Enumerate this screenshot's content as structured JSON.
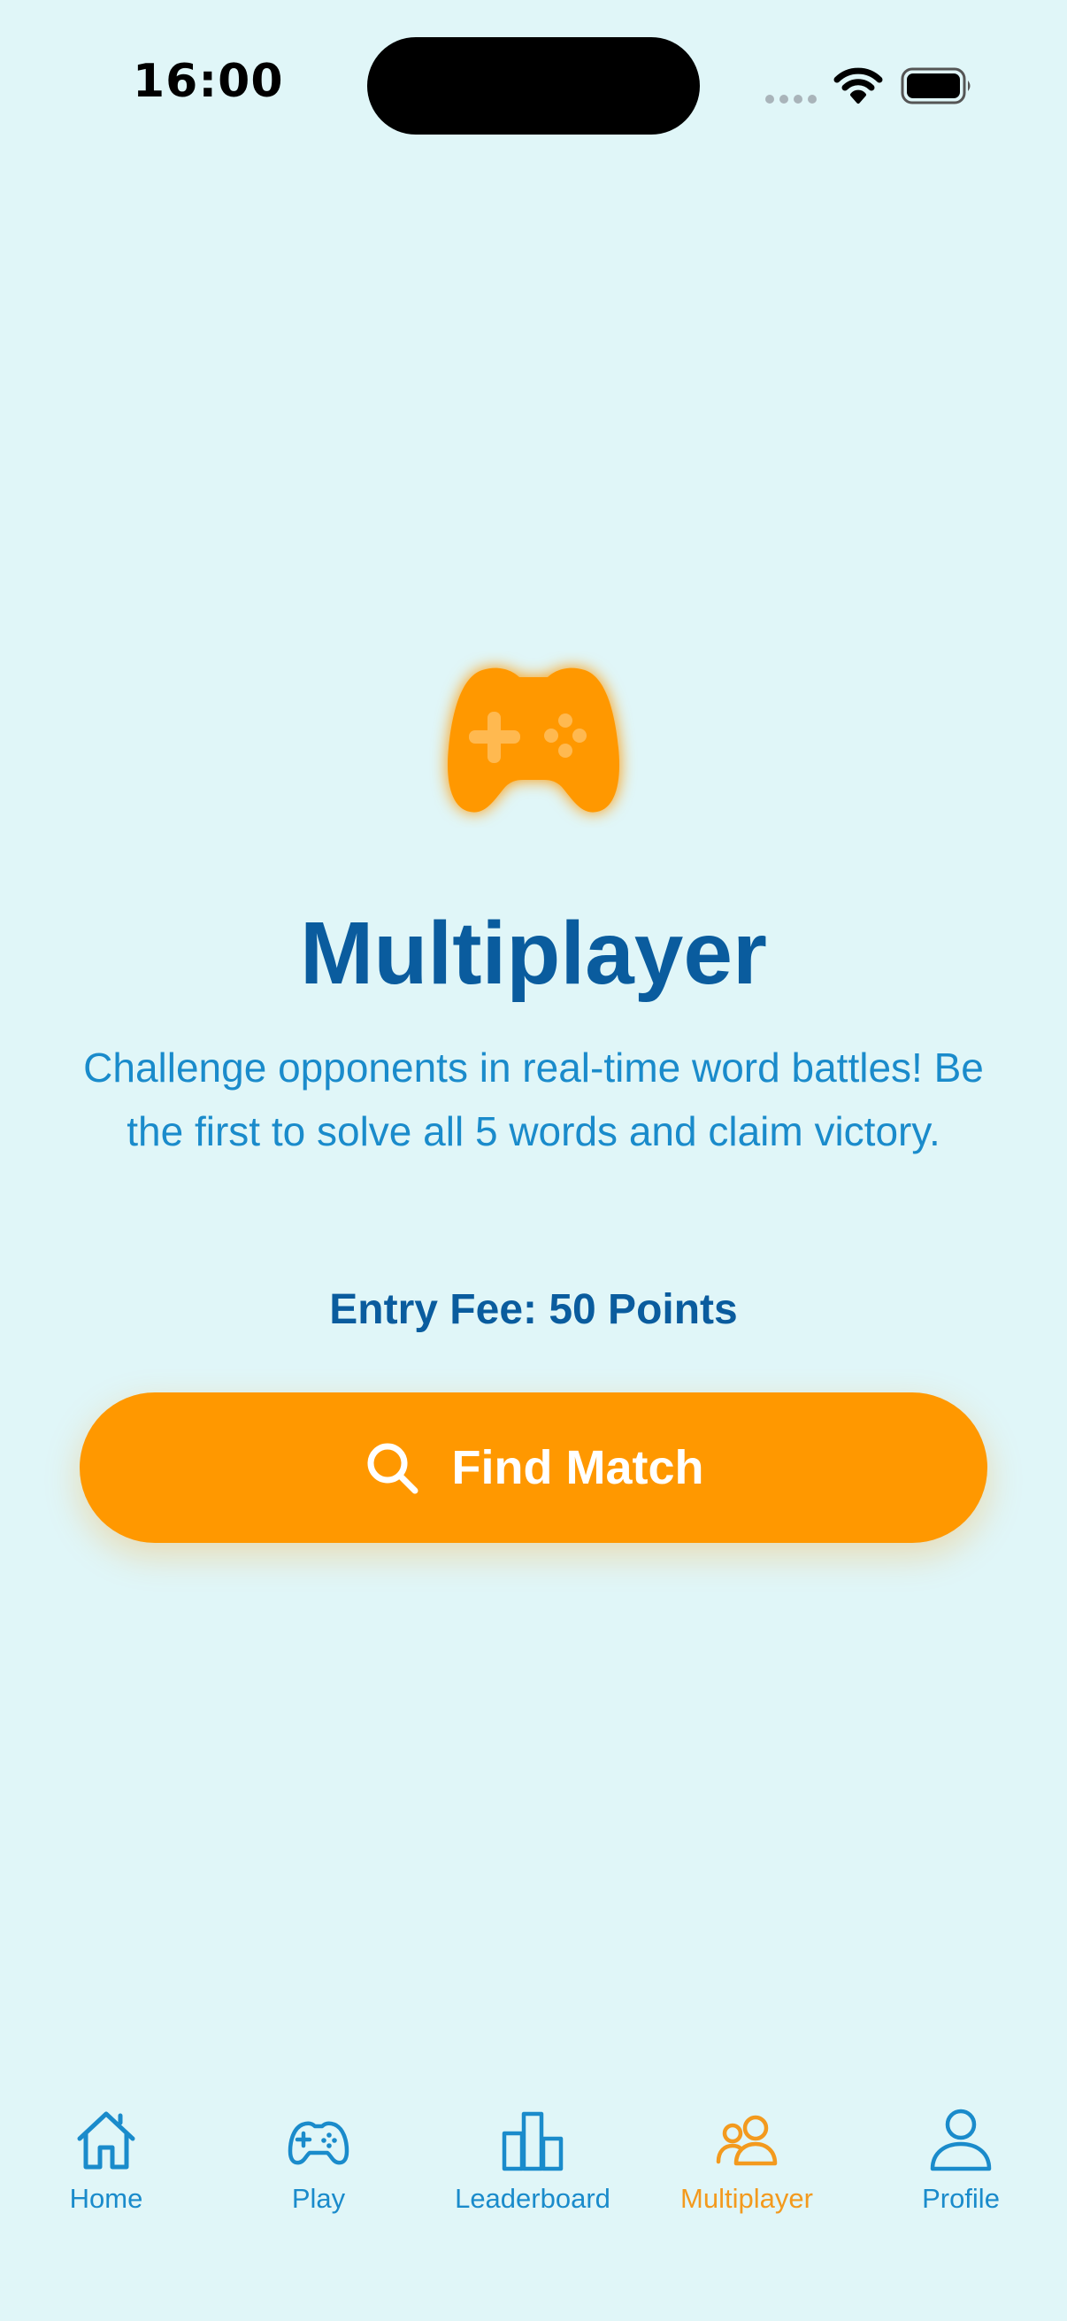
{
  "status_bar": {
    "time": "16:00"
  },
  "colors": {
    "background": "#E0F6F8",
    "primary_dark": "#0A5C9E",
    "primary": "#1A8BCB",
    "accent": "#FF9800",
    "active_tab": "#F39A1E"
  },
  "hero": {
    "icon": "gamepad-icon"
  },
  "main": {
    "title": "Multiplayer",
    "description": "Challenge opponents in real-time word battles! Be the first to solve all 5 words and claim victory.",
    "entry_fee": "Entry Fee: 50 Points",
    "find_match_label": "Find Match",
    "find_match_icon": "search-icon"
  },
  "tabs": [
    {
      "label": "Home",
      "icon": "home-icon",
      "active": false
    },
    {
      "label": "Play",
      "icon": "gamepad-icon",
      "active": false
    },
    {
      "label": "Leaderboard",
      "icon": "bar-chart-icon",
      "active": false
    },
    {
      "label": "Multiplayer",
      "icon": "users-icon",
      "active": true
    },
    {
      "label": "Profile",
      "icon": "user-icon",
      "active": false
    }
  ]
}
